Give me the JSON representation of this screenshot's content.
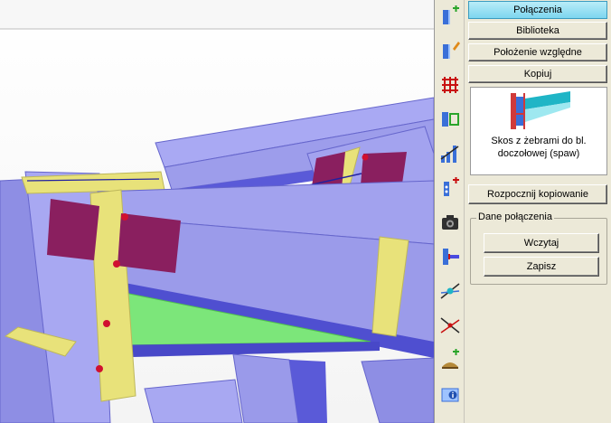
{
  "toolbar": {
    "icons": [
      "add-beam-icon",
      "edit-beam-icon",
      "grid-icon",
      "connection-icon",
      "chart-icon",
      "add-node-icon",
      "camera-icon",
      "column-beam-icon",
      "node-axis-icon",
      "line-cross-icon",
      "add-support-icon",
      "info-icon"
    ]
  },
  "panel": {
    "tabs": [
      "Połączenia",
      "Biblioteka",
      "Położenie względne",
      "Kopiuj"
    ],
    "active_tab": "Połączenia",
    "preview_label_line1": "Skos z żebrami do bl.",
    "preview_label_line2": "doczołowej (spaw)",
    "copy_button": "Rozpocznij kopiowanie",
    "group_title": "Dane połączenia",
    "load_button": "Wczytaj",
    "save_button": "Zapisz"
  },
  "colors": {
    "steel": "#a6a6f2",
    "steel_dark": "#4f4fd0",
    "plate": "#e8e27a",
    "stiffener": "#8a1f5f",
    "haunch": "#7ce67a",
    "active_tab": "#8fdcf2"
  }
}
